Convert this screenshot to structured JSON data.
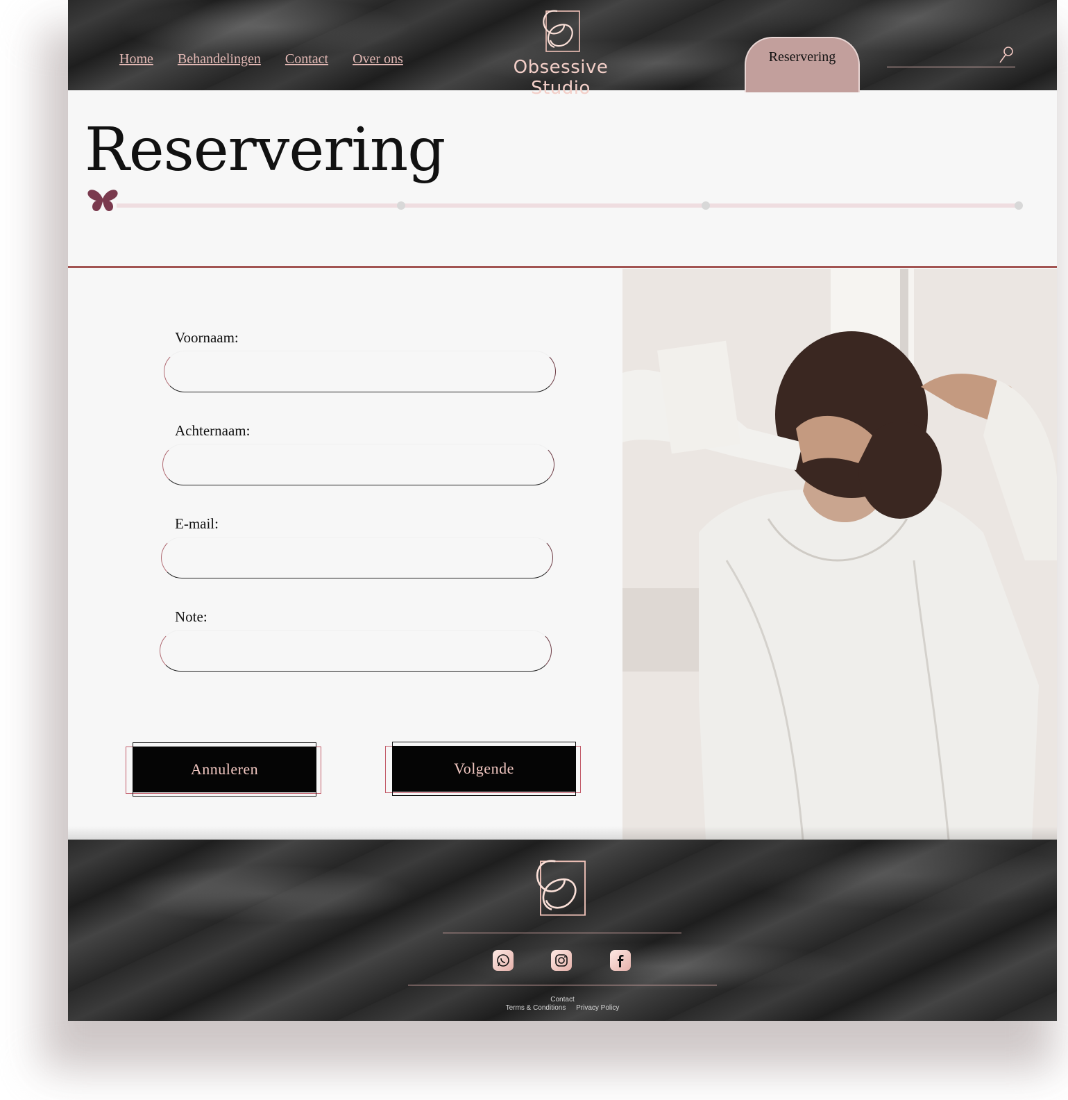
{
  "header": {
    "nav": [
      "Home",
      "Behandelingen",
      "Contact",
      "Over ons"
    ],
    "brand": "Obsessive Studio",
    "reservation_tab": "Reservering",
    "search_placeholder": ""
  },
  "page": {
    "title": "Reservering",
    "steps_total": 4,
    "current_step": 1
  },
  "form": {
    "fields": [
      {
        "label": "Voornaam:",
        "value": ""
      },
      {
        "label": "Achternaam:",
        "value": ""
      },
      {
        "label": "E-mail:",
        "value": ""
      },
      {
        "label": "Note:",
        "value": ""
      }
    ],
    "cancel_label": "Annuleren",
    "next_label": "Volgende"
  },
  "footer": {
    "social": [
      "whatsapp-icon",
      "instagram-icon",
      "facebook-icon"
    ],
    "links_top": "Contact",
    "links_bottom": [
      "Terms & Conditions",
      "Privacy Policy"
    ]
  },
  "colors": {
    "accent": "#e2b8b4",
    "tab": "#c29f9c",
    "divider": "#a25452",
    "butterfly": "#7a3a4e"
  }
}
